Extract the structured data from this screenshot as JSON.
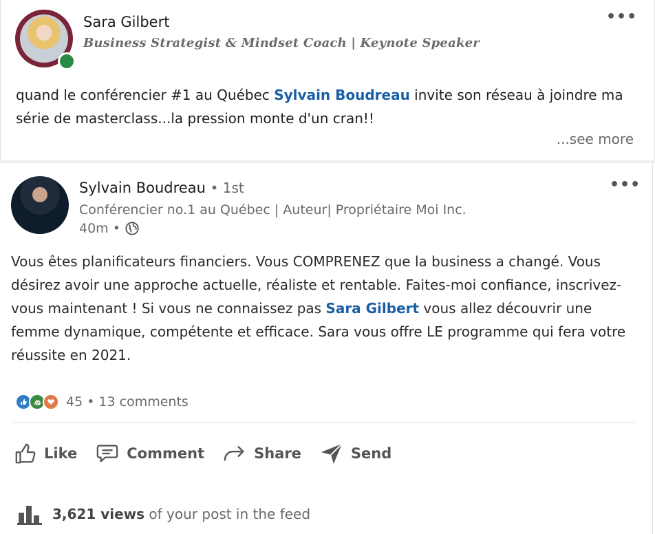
{
  "original_post": {
    "author_name": "Sara Gilbert",
    "author_headline": "Business Strategist & Mindset Coach | Keynote Speaker",
    "text_before": "quand le conférencier #1 au Québec ",
    "mention": "Sylvain Boudreau",
    "text_after": " invite son réseau à joindre ma série de masterclass...la pression monte d'un cran!!",
    "see_more": "...see more",
    "menu_icon": "more-horizontal-icon"
  },
  "shared_post": {
    "author_name": "Sylvain Boudreau",
    "connection_degree": "• 1st",
    "author_headline": "Conférencier no.1 au Québec | Auteur| Propriétaire Moi Inc.",
    "time": "40m •",
    "visibility_icon": "globe-icon",
    "text_before": "Vous êtes planificateurs financiers. Vous COMPRENEZ que la business a changé. Vous désirez avoir une approche actuelle, réaliste et rentable. Faites-moi confiance, inscrivez-vous maintenant ! Si vous ne connaissez pas ",
    "mention": "Sara Gilbert",
    "text_after": " vous allez découvrir une femme dynamique, compétente et efficace. Sara vous offre LE programme qui fera votre réussite en 2021.",
    "reactions": {
      "icons": [
        "like-icon",
        "support-icon",
        "love-icon"
      ],
      "count": "45",
      "separator": "•",
      "comments": "13 comments"
    },
    "actions": {
      "like": "Like",
      "comment": "Comment",
      "share": "Share",
      "send": "Send"
    },
    "views": {
      "count": "3,621 views",
      "suffix": " of your post in the feed"
    }
  },
  "colors": {
    "mention": "#1a5fa5",
    "online": "#2a8a43",
    "muted": "#6a6a6a"
  }
}
